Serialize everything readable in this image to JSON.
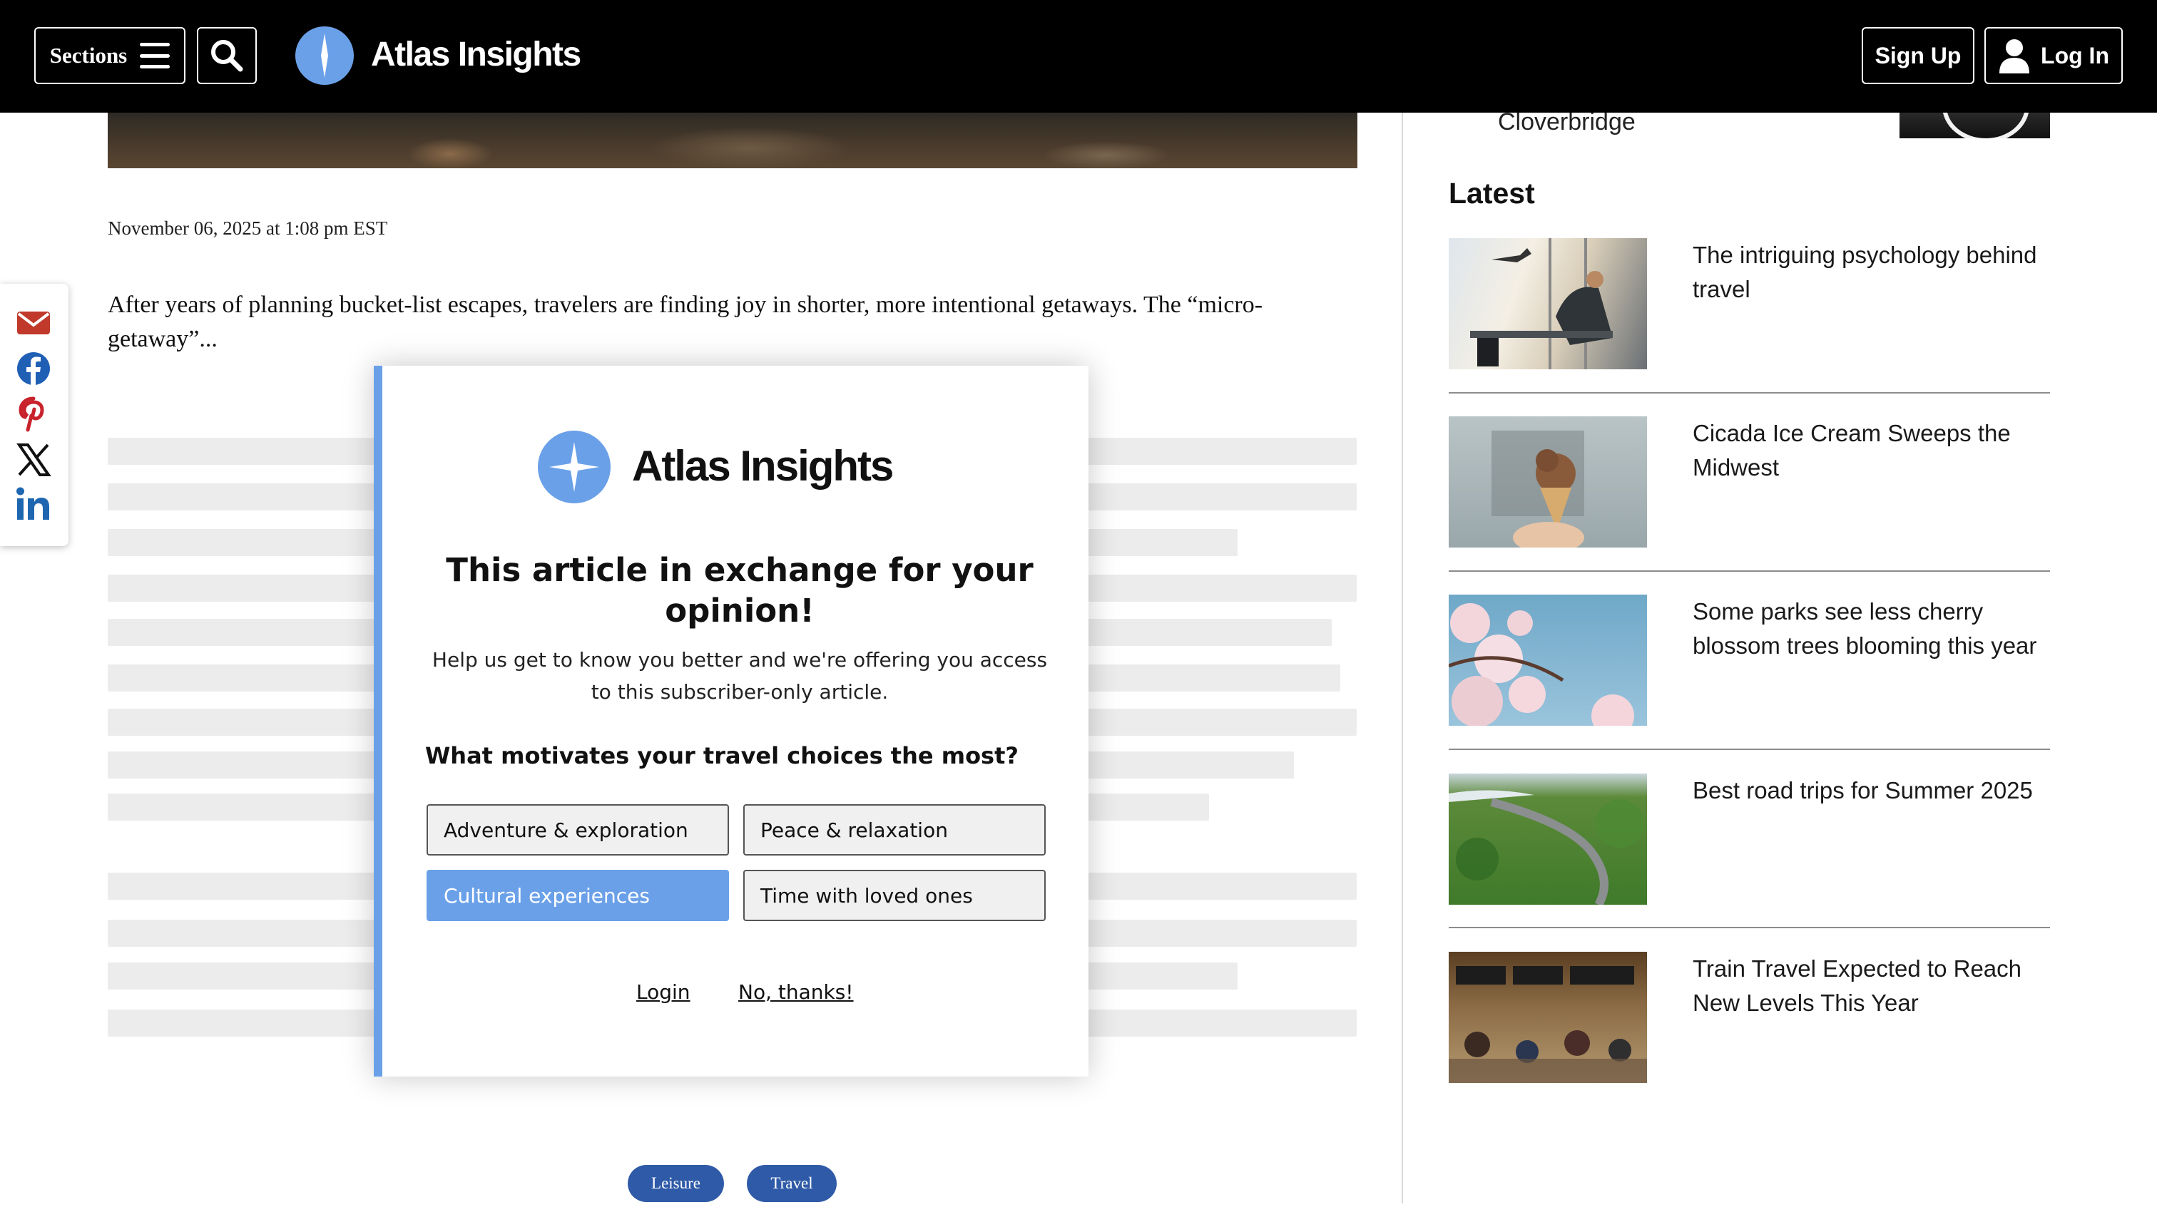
{
  "header": {
    "sections_label": "Sections",
    "brand_name": "Atlas Insights",
    "signup_label": "Sign Up",
    "login_label": "Log In",
    "icons": [
      "hamburger-icon",
      "search-icon",
      "compass-logo",
      "user-icon"
    ]
  },
  "article": {
    "date": "November 06, 2025 at 1:08 pm EST",
    "intro": "After years of planning bucket-list escapes, travelers are finding joy in shorter, more intentional getaways. The “micro-getaway”...",
    "tags": [
      "Leisure",
      "Travel"
    ]
  },
  "share": {
    "icons": [
      "email-icon",
      "facebook-icon",
      "pinterest-icon",
      "x-icon",
      "linkedin-icon"
    ]
  },
  "sidebar": {
    "prev_item_title": "Cloverbridge",
    "latest_heading": "Latest",
    "latest": [
      {
        "title": "The intriguing psychology behind travel"
      },
      {
        "title": "Cicada Ice Cream Sweeps the Midwest"
      },
      {
        "title": "Some parks see less cherry blossom trees blooming this year"
      },
      {
        "title": "Best road trips for Summer 2025"
      },
      {
        "title": "Train Travel Expected to Reach New Levels This Year"
      }
    ]
  },
  "modal": {
    "brand_name": "Atlas Insights",
    "heading": "This article in exchange for your opinion!",
    "subtext": "Help us get to know you better and we're offering you access to this subscriber-only article.",
    "question": "What motivates your travel choices the most?",
    "options": [
      {
        "label": "Adventure & exploration",
        "selected": false
      },
      {
        "label": "Peace & relaxation",
        "selected": false
      },
      {
        "label": "Cultural experiences",
        "selected": true
      },
      {
        "label": "Time with loved ones",
        "selected": false
      }
    ],
    "login_link": "Login",
    "dismiss_link": "No, thanks!"
  },
  "colors": {
    "accent": "#6aa0e8",
    "tag_bg": "#2f5aa8",
    "topbar_bg": "#000000"
  }
}
